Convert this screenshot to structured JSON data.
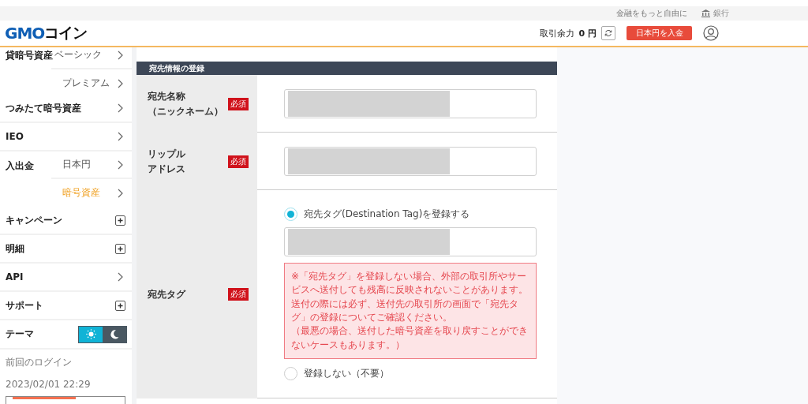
{
  "utility_bar": {
    "tagline": "金融をもっと自由に",
    "bank_link": "銀行"
  },
  "header": {
    "logo_latin": "GMO",
    "logo_kana": "コイン",
    "balance_label": "取引余力",
    "balance_value": "0 円",
    "deposit_button": "日本円を入金"
  },
  "sidebar": {
    "items": [
      {
        "label": "貸暗号資産",
        "kind": "group",
        "children": [
          {
            "label": "ベーシック",
            "selected": false
          },
          {
            "label": "プレミアム",
            "selected": false
          }
        ]
      },
      {
        "label": "つみたて暗号資産",
        "kind": "chevron"
      },
      {
        "label": "IEO",
        "kind": "chevron"
      },
      {
        "label": "入出金",
        "kind": "group",
        "children": [
          {
            "label": "日本円",
            "selected": false
          },
          {
            "label": "暗号資産",
            "selected": true
          }
        ]
      },
      {
        "label": "キャンペーン",
        "kind": "plus"
      },
      {
        "label": "明細",
        "kind": "plus"
      },
      {
        "label": "API",
        "kind": "chevron"
      },
      {
        "label": "サポート",
        "kind": "plus"
      }
    ],
    "theme": {
      "label": "テーマ",
      "light_selected": true
    },
    "last_login": {
      "label": "前回のログイン",
      "time": "2023/02/01 22:29"
    }
  },
  "form": {
    "title": "宛先情報の登録",
    "rows": [
      {
        "label_lines": [
          "宛先名称",
          "（ニックネーム）"
        ],
        "badge": "必須",
        "kind": "text",
        "redacted": true
      },
      {
        "label_lines": [
          "リップル",
          "アドレス"
        ],
        "badge": "必須",
        "kind": "text",
        "redacted": true
      },
      {
        "label_lines": [
          "宛先タグ"
        ],
        "badge": "必須",
        "kind": "tag",
        "options": [
          {
            "label": "宛先タグ(Destination Tag)を登録する",
            "selected": true
          },
          {
            "label": "登録しない（不要）",
            "selected": false
          }
        ],
        "redacted": true,
        "warning": [
          "※「宛先タグ」を登録しない場合、外部の取引所やサービスへ送付しても残高に反映されないことがあります。送付の際には必ず、送付先の取引所の画面で「宛先タグ」の登録についてご確認ください。",
          "（最悪の場合、送付した暗号資産を取り戻すことができないケースもあります。）"
        ]
      }
    ]
  }
}
